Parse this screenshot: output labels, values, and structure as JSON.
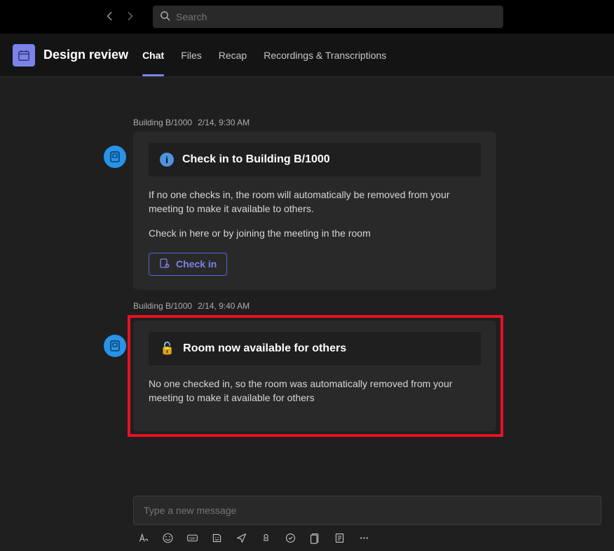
{
  "search": {
    "placeholder": "Search"
  },
  "header": {
    "title": "Design review",
    "tabs": [
      {
        "label": "Chat",
        "active": true
      },
      {
        "label": "Files",
        "active": false
      },
      {
        "label": "Recap",
        "active": false
      },
      {
        "label": "Recordings & Transcriptions",
        "active": false
      }
    ]
  },
  "messages": [
    {
      "sender": "Building B/1000",
      "timestamp": "2/14, 9:30 AM",
      "card": {
        "icon": "info",
        "title": "Check in to Building B/1000",
        "body1": "If no one checks in, the room will automatically be removed from your meeting to make it available to others.",
        "body2": "Check in here or by joining the meeting in the room",
        "button": "Check in"
      }
    },
    {
      "sender": "Building B/1000",
      "timestamp": "2/14, 9:40 AM",
      "card": {
        "icon": "unlock",
        "title": "Room now available for others",
        "body1": "No one checked in, so the room was automatically removed from your meeting to make it available for others"
      }
    }
  ],
  "compose": {
    "placeholder": "Type a new message"
  }
}
